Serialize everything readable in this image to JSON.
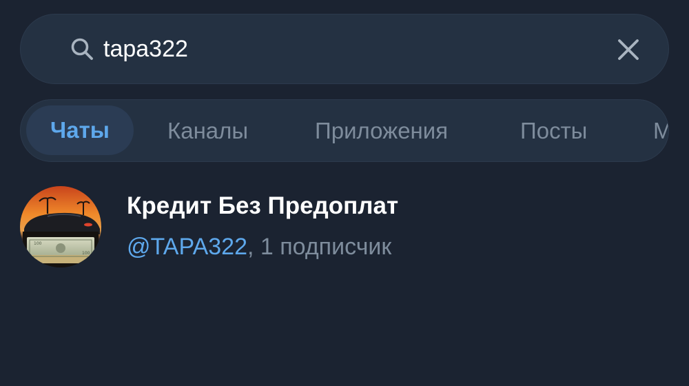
{
  "search": {
    "query": "tapa322",
    "icon": "search-icon",
    "clear_icon": "close-icon"
  },
  "tabs": [
    {
      "label": "Чаты",
      "active": true
    },
    {
      "label": "Каналы",
      "active": false
    },
    {
      "label": "Приложения",
      "active": false
    },
    {
      "label": "Посты",
      "active": false
    },
    {
      "label": "М",
      "active": false
    }
  ],
  "results": [
    {
      "title": "Кредит Без Предоплат",
      "username": "@TAPA322",
      "separator": ", ",
      "subscribers": "1 подписчик",
      "avatar": "avatar-car-and-money-image"
    }
  ],
  "colors": {
    "background": "#1b2331",
    "surface": "#243142",
    "accent": "#5ea8ec",
    "muted": "#7e8c9c",
    "text": "#ffffff"
  }
}
